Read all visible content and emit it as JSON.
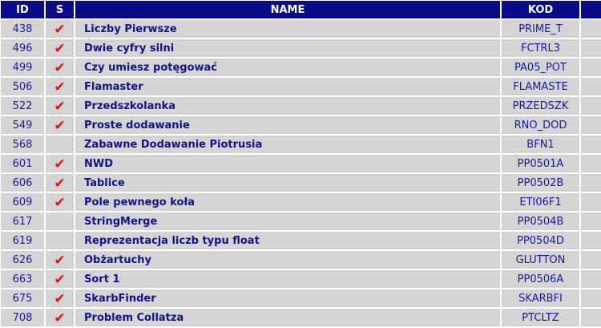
{
  "headers": {
    "id": "ID",
    "s": "S",
    "name": "NAME",
    "kod": "KOD"
  },
  "rows": [
    {
      "id": "438",
      "solved": true,
      "name": "Liczby Pierwsze",
      "kod": "PRIME_T"
    },
    {
      "id": "496",
      "solved": true,
      "name": "Dwie cyfry silni",
      "kod": "FCTRL3"
    },
    {
      "id": "499",
      "solved": true,
      "name": "Czy umiesz potęgować",
      "kod": "PA05_POT"
    },
    {
      "id": "506",
      "solved": true,
      "name": "Flamaster",
      "kod": "FLAMASTE"
    },
    {
      "id": "522",
      "solved": true,
      "name": "Przedszkolanka",
      "kod": "PRZEDSZK"
    },
    {
      "id": "549",
      "solved": true,
      "name": "Proste dodawanie",
      "kod": "RNO_DOD"
    },
    {
      "id": "568",
      "solved": false,
      "name": "Zabawne Dodawanie Piotrusia",
      "kod": "BFN1"
    },
    {
      "id": "601",
      "solved": true,
      "name": "NWD",
      "kod": "PP0501A"
    },
    {
      "id": "606",
      "solved": true,
      "name": "Tablice",
      "kod": "PP0502B"
    },
    {
      "id": "609",
      "solved": true,
      "name": "Pole pewnego koła",
      "kod": "ETI06F1"
    },
    {
      "id": "617",
      "solved": false,
      "name": "StringMerge",
      "kod": "PP0504B"
    },
    {
      "id": "619",
      "solved": false,
      "name": "Reprezentacja liczb typu float",
      "kod": "PP0504D"
    },
    {
      "id": "626",
      "solved": true,
      "name": "Obżartuchy",
      "kod": "GLUTTON"
    },
    {
      "id": "663",
      "solved": true,
      "name": "Sort 1",
      "kod": "PP0506A"
    },
    {
      "id": "675",
      "solved": true,
      "name": "SkarbFinder",
      "kod": "SKARBFI"
    },
    {
      "id": "708",
      "solved": true,
      "name": "Problem Collatza",
      "kod": "PTCLTZ"
    }
  ],
  "solved_mark": "✔",
  "colors": {
    "header_bg": "#0a0a8a",
    "cell_bg": "#d4d4d4",
    "link_text": "#13138f",
    "check": "#e8101a"
  }
}
